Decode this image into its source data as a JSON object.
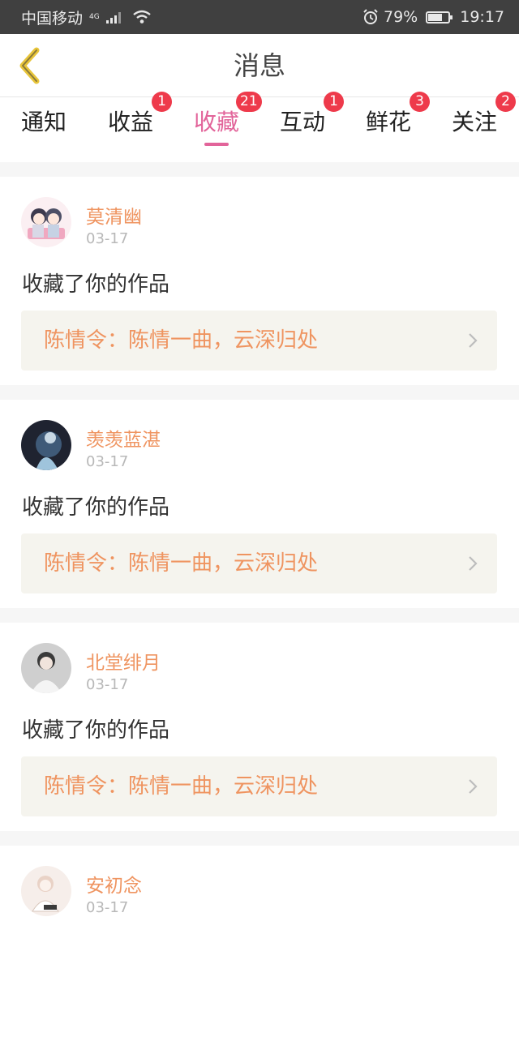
{
  "status_bar": {
    "carrier": "中国移动",
    "network": "4G",
    "battery_percent": "79%",
    "battery_level": 0.79,
    "time": "19:17"
  },
  "header": {
    "title": "消息",
    "back_icon": "chevron-left-icon",
    "back_color": "#e8c53a"
  },
  "tabs": [
    {
      "label": "通知",
      "badge": ""
    },
    {
      "label": "收益",
      "badge": "1"
    },
    {
      "label": "收藏",
      "badge": "21",
      "active": true
    },
    {
      "label": "互动",
      "badge": "1"
    },
    {
      "label": "鲜花",
      "badge": "3"
    },
    {
      "label": "关注",
      "badge": "2"
    }
  ],
  "colors": {
    "accent": "#e2649a",
    "name": "#ef9460",
    "badge": "#ee3a4b"
  },
  "items": [
    {
      "user": "莫清幽",
      "date": "03-17",
      "action": "收藏了你的作品",
      "work": "陈情令：陈情一曲，云深归处"
    },
    {
      "user": "羡羡蓝湛",
      "date": "03-17",
      "action": "收藏了你的作品",
      "work": "陈情令：陈情一曲，云深归处"
    },
    {
      "user": "北堂绯月",
      "date": "03-17",
      "action": "收藏了你的作品",
      "work": "陈情令：陈情一曲，云深归处"
    },
    {
      "user": "安初念",
      "date": "03-17",
      "action": "",
      "work": ""
    }
  ]
}
